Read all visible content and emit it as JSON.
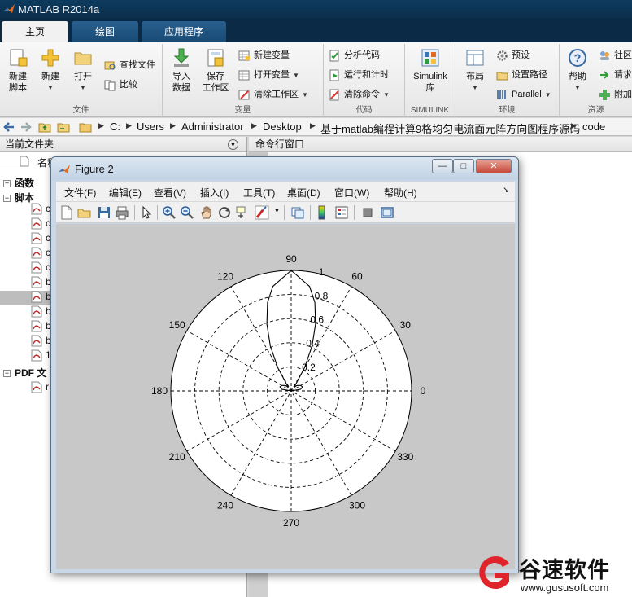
{
  "app": {
    "title": "MATLAB R2014a",
    "tabs": [
      {
        "label": "主页",
        "active": true
      },
      {
        "label": "绘图",
        "active": false
      },
      {
        "label": "应用程序",
        "active": false
      }
    ]
  },
  "ribbon": {
    "file": {
      "group": "文件",
      "new_script": "新建\n脚本",
      "new": "新建",
      "open": "打开",
      "find_files": "查找文件",
      "compare": "比较"
    },
    "variable": {
      "group": "变量",
      "import": "导入\n数据",
      "save_workspace": "保存\n工作区",
      "new_variable": "新建变量",
      "open_variable": "打开变量",
      "clear_workspace": "清除工作区"
    },
    "code": {
      "group": "代码",
      "analyze": "分析代码",
      "run_time": "运行和计时",
      "clear_commands": "清除命令"
    },
    "simulink": {
      "group": "SIMULINK",
      "library": "Simulink\n库"
    },
    "environment": {
      "group": "环境",
      "layout": "布局",
      "preferences": "预设",
      "set_path": "设置路径",
      "parallel": "Parallel"
    },
    "resources": {
      "group": "资源",
      "help": "帮助",
      "community": "社区",
      "request": "请求",
      "addons": "附加"
    }
  },
  "address": {
    "crumbs": [
      "C:",
      "Users",
      "Administrator",
      "Desktop",
      "基于matlab编程计算9格均匀电流面元阵方向图程序源码",
      "code"
    ]
  },
  "left_panel": {
    "title": "当前文件夹",
    "column_name": "名称",
    "groups": [
      {
        "label": "函数",
        "expanded": false
      },
      {
        "label": "脚本",
        "expanded": true
      },
      {
        "label": "PDF 文",
        "expanded": true
      }
    ],
    "script_items": [
      "c",
      "c",
      "c",
      "c",
      "c",
      "b",
      "b",
      "b",
      "b",
      "b",
      "1"
    ],
    "pdf_items": [
      "r"
    ]
  },
  "right_panel": {
    "title": "命令行窗口"
  },
  "figure": {
    "title": "Figure 2",
    "menu": [
      "文件(F)",
      "编辑(E)",
      "查看(V)",
      "插入(I)",
      "工具(T)",
      "桌面(D)",
      "窗口(W)",
      "帮助(H)"
    ],
    "toolbar_icons": [
      "new-figure-icon",
      "open-icon",
      "save-icon",
      "print-icon",
      "pointer-icon",
      "zoom-in-icon",
      "zoom-out-icon",
      "pan-icon",
      "rotate-icon",
      "data-cursor-icon",
      "brush-icon",
      "link-icon",
      "colorbar-icon",
      "legend-icon",
      "hide-plot-tools-icon",
      "show-plot-tools-icon"
    ]
  },
  "chart_data": {
    "type": "polar",
    "angle_ticks": [
      "0",
      "30",
      "60",
      "90",
      "120",
      "150",
      "180",
      "210",
      "240",
      "270",
      "300",
      "330"
    ],
    "radial_ticks": [
      "0.2",
      "0.4",
      "0.6",
      "0.8",
      "1"
    ],
    "rlim": [
      0,
      1
    ],
    "grid": true,
    "series": [
      {
        "angle_deg": [
          90,
          80,
          75,
          70,
          65,
          60,
          55,
          50,
          45,
          40,
          30,
          20,
          10,
          0,
          180,
          170,
          160,
          150,
          140,
          135,
          130,
          125,
          120,
          115,
          110,
          105,
          100,
          90
        ],
        "r": [
          1.0,
          0.88,
          0.76,
          0.59,
          0.41,
          0.22,
          0.06,
          0.04,
          0.06,
          0.07,
          0.09,
          0.1,
          0.08,
          0.0,
          0.0,
          0.08,
          0.1,
          0.09,
          0.07,
          0.06,
          0.04,
          0.06,
          0.22,
          0.41,
          0.59,
          0.76,
          0.88,
          1.0
        ]
      }
    ]
  },
  "watermark": {
    "text": "谷速软件",
    "url": "www.gususoft.com"
  },
  "colors": {
    "title_bar": "#0d3b5e",
    "ribbon_bg": "#efefef",
    "figure_canvas": "#c8c8c8",
    "watermark_red": "#e0242b"
  }
}
